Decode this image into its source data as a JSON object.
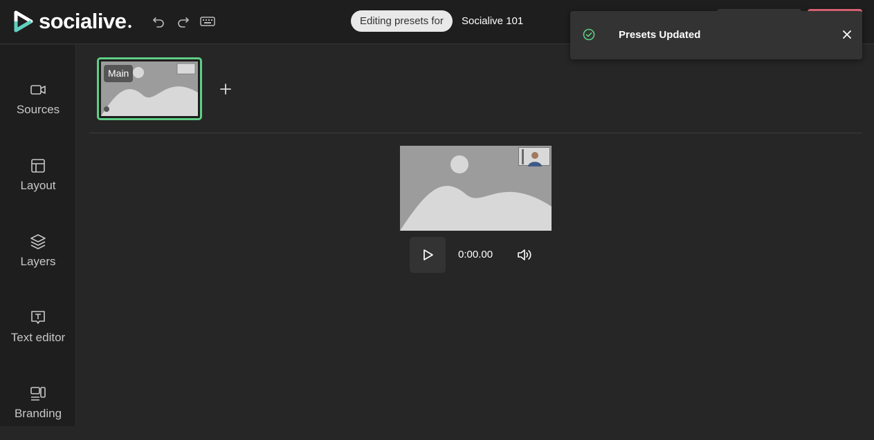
{
  "header": {
    "logo_text": "socialive",
    "editing_label": "Editing presets for",
    "preset_name": "Socialive 101"
  },
  "toast": {
    "message": "Presets Updated",
    "status_color": "#5fcf84"
  },
  "sidebar": {
    "items": [
      {
        "label": "Sources",
        "icon": "video-camera-icon"
      },
      {
        "label": "Layout",
        "icon": "layout-icon"
      },
      {
        "label": "Layers",
        "icon": "layers-icon"
      },
      {
        "label": "Text editor",
        "icon": "text-box-icon"
      },
      {
        "label": "Branding",
        "icon": "branding-icon"
      }
    ]
  },
  "presets": {
    "items": [
      {
        "label": "Main",
        "selected": true
      }
    ]
  },
  "player": {
    "timecode": "0:00.00"
  },
  "colors": {
    "accent": "#5fcf84",
    "brand_button": "#e86a7c"
  }
}
